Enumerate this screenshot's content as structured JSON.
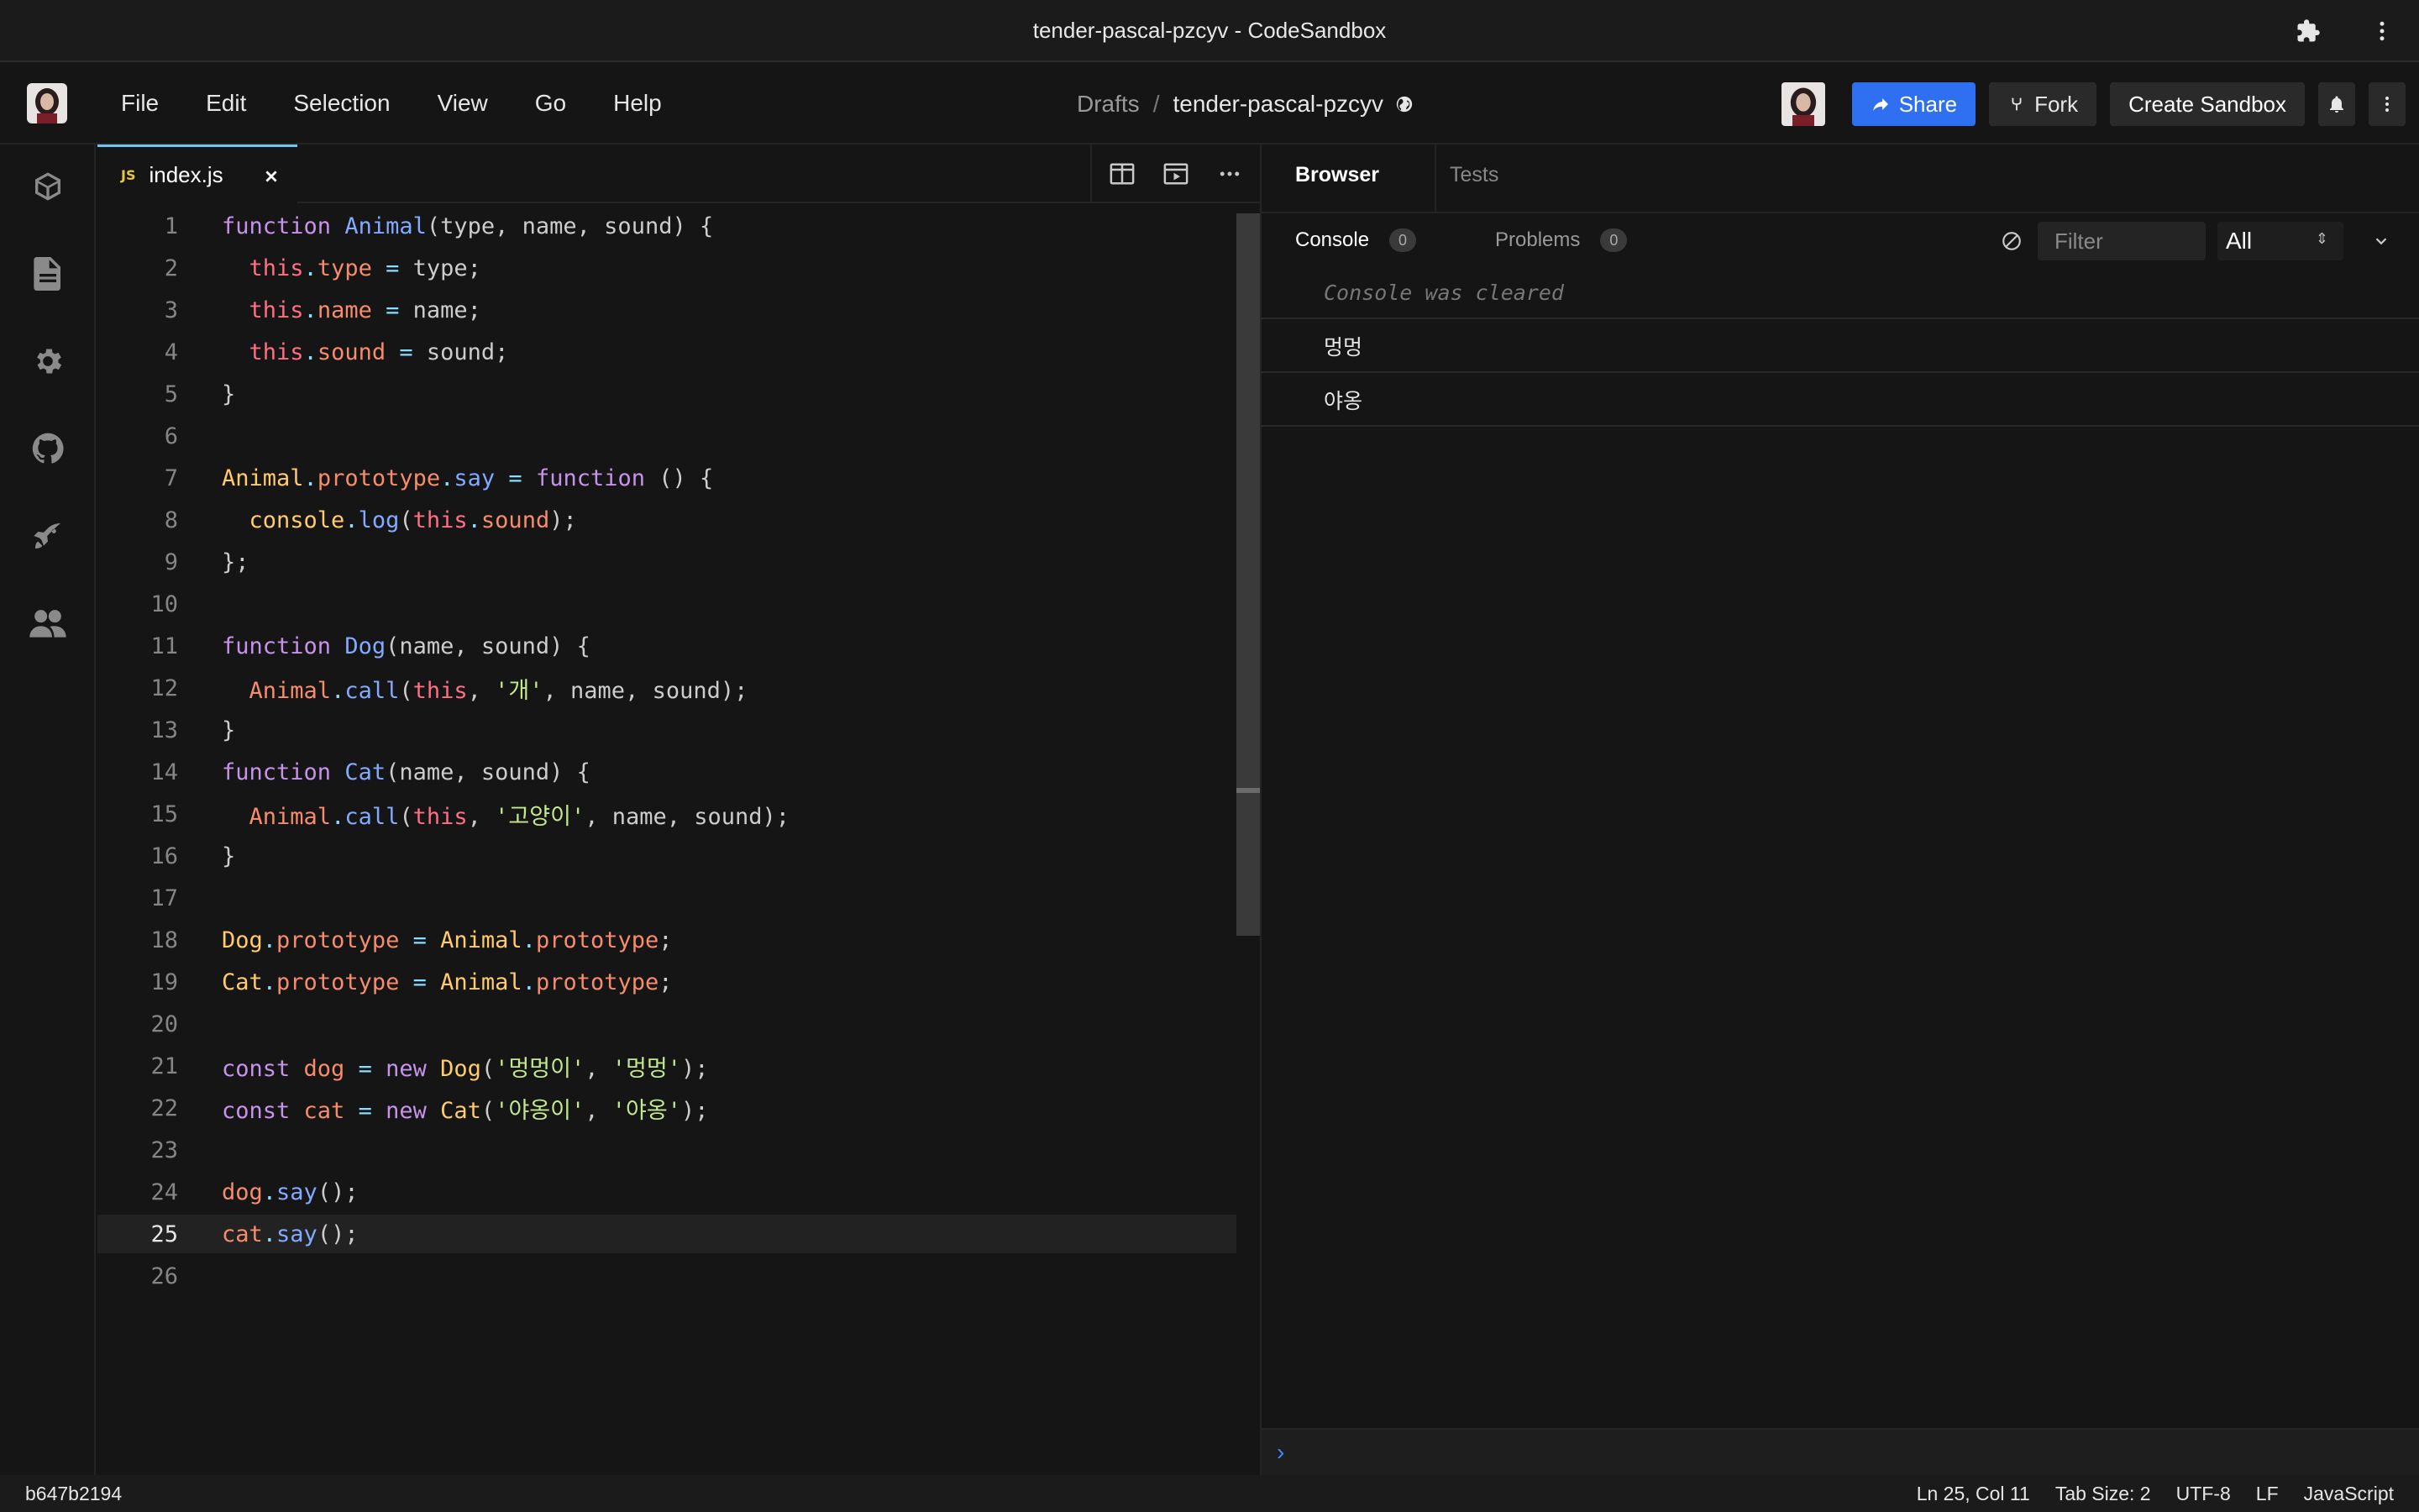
{
  "window": {
    "title": "tender-pascal-pzcyv - CodeSandbox"
  },
  "menu": [
    "File",
    "Edit",
    "Selection",
    "View",
    "Go",
    "Help"
  ],
  "breadcrumb": {
    "folder": "Drafts",
    "separator": "/",
    "sandbox": "tender-pascal-pzcyv"
  },
  "header_actions": {
    "share": "Share",
    "fork": "Fork",
    "create": "Create Sandbox"
  },
  "activity_icons": [
    "cube-icon",
    "file-icon",
    "gear-icon",
    "github-icon",
    "rocket-icon",
    "users-icon"
  ],
  "editor": {
    "tab": {
      "badge": "JS",
      "filename": "index.js"
    },
    "current_line": 25,
    "lines": [
      [
        [
          "function ",
          "k"
        ],
        [
          "Animal",
          "f"
        ],
        [
          "(type, name, sound) {",
          "p"
        ]
      ],
      [
        [
          "  ",
          "p"
        ],
        [
          "this",
          "r"
        ],
        [
          ".",
          "o"
        ],
        [
          "type",
          "t"
        ],
        [
          " = ",
          "o"
        ],
        [
          "type;",
          "p"
        ]
      ],
      [
        [
          "  ",
          "p"
        ],
        [
          "this",
          "r"
        ],
        [
          ".",
          "o"
        ],
        [
          "name",
          "t"
        ],
        [
          " = ",
          "o"
        ],
        [
          "name;",
          "p"
        ]
      ],
      [
        [
          "  ",
          "p"
        ],
        [
          "this",
          "r"
        ],
        [
          ".",
          "o"
        ],
        [
          "sound",
          "t"
        ],
        [
          " = ",
          "o"
        ],
        [
          "sound;",
          "p"
        ]
      ],
      [
        [
          "}",
          "p"
        ]
      ],
      [],
      [
        [
          "Animal",
          "c"
        ],
        [
          ".",
          "o"
        ],
        [
          "prototype",
          "t"
        ],
        [
          ".",
          "o"
        ],
        [
          "say",
          "f"
        ],
        [
          " = ",
          "o"
        ],
        [
          "function",
          "k"
        ],
        [
          " () {",
          "p"
        ]
      ],
      [
        [
          "  ",
          "p"
        ],
        [
          "console",
          "c"
        ],
        [
          ".",
          "o"
        ],
        [
          "log",
          "f"
        ],
        [
          "(",
          "p"
        ],
        [
          "this",
          "r"
        ],
        [
          ".",
          "o"
        ],
        [
          "sound",
          "t"
        ],
        [
          ");",
          "p"
        ]
      ],
      [
        [
          "};",
          "p"
        ]
      ],
      [],
      [
        [
          "function ",
          "k"
        ],
        [
          "Dog",
          "f"
        ],
        [
          "(name, sound) {",
          "p"
        ]
      ],
      [
        [
          "  ",
          "p"
        ],
        [
          "Animal",
          "t"
        ],
        [
          ".",
          "o"
        ],
        [
          "call",
          "f"
        ],
        [
          "(",
          "p"
        ],
        [
          "this",
          "r"
        ],
        [
          ", ",
          "p"
        ],
        [
          "'개'",
          "s"
        ],
        [
          ", name, sound);",
          "p"
        ]
      ],
      [
        [
          "}",
          "p"
        ]
      ],
      [
        [
          "function ",
          "k"
        ],
        [
          "Cat",
          "f"
        ],
        [
          "(name, sound) {",
          "p"
        ]
      ],
      [
        [
          "  ",
          "p"
        ],
        [
          "Animal",
          "t"
        ],
        [
          ".",
          "o"
        ],
        [
          "call",
          "f"
        ],
        [
          "(",
          "p"
        ],
        [
          "this",
          "r"
        ],
        [
          ", ",
          "p"
        ],
        [
          "'고양이'",
          "s"
        ],
        [
          ", name, sound);",
          "p"
        ]
      ],
      [
        [
          "}",
          "p"
        ]
      ],
      [],
      [
        [
          "Dog",
          "c"
        ],
        [
          ".",
          "o"
        ],
        [
          "prototype",
          "t"
        ],
        [
          " = ",
          "o"
        ],
        [
          "Animal",
          "c"
        ],
        [
          ".",
          "o"
        ],
        [
          "prototype",
          "t"
        ],
        [
          ";",
          "p"
        ]
      ],
      [
        [
          "Cat",
          "c"
        ],
        [
          ".",
          "o"
        ],
        [
          "prototype",
          "t"
        ],
        [
          " = ",
          "o"
        ],
        [
          "Animal",
          "c"
        ],
        [
          ".",
          "o"
        ],
        [
          "prototype",
          "t"
        ],
        [
          ";",
          "p"
        ]
      ],
      [],
      [
        [
          "const ",
          "k"
        ],
        [
          "dog",
          "t"
        ],
        [
          " = ",
          "o"
        ],
        [
          "new ",
          "k"
        ],
        [
          "Dog",
          "c"
        ],
        [
          "(",
          "p"
        ],
        [
          "'멍멍이'",
          "s"
        ],
        [
          ", ",
          "p"
        ],
        [
          "'멍멍'",
          "s"
        ],
        [
          ");",
          "p"
        ]
      ],
      [
        [
          "const ",
          "k"
        ],
        [
          "cat",
          "t"
        ],
        [
          " = ",
          "o"
        ],
        [
          "new ",
          "k"
        ],
        [
          "Cat",
          "c"
        ],
        [
          "(",
          "p"
        ],
        [
          "'야옹이'",
          "s"
        ],
        [
          ", ",
          "p"
        ],
        [
          "'야옹'",
          "s"
        ],
        [
          ");",
          "p"
        ]
      ],
      [],
      [
        [
          "dog",
          "t"
        ],
        [
          ".",
          "o"
        ],
        [
          "say",
          "f"
        ],
        [
          "();",
          "p"
        ]
      ],
      [
        [
          "cat",
          "t"
        ],
        [
          ".",
          "o"
        ],
        [
          "say",
          "f"
        ],
        [
          "();",
          "p"
        ]
      ],
      []
    ]
  },
  "panel": {
    "tabs": [
      "Browser",
      "Tests"
    ],
    "console_tab": "Console",
    "console_count": "0",
    "problems_tab": "Problems",
    "problems_count": "0",
    "filter_placeholder": "Filter",
    "level": "All",
    "cleared_message": "Console was cleared",
    "logs": [
      "멍멍",
      "야옹"
    ],
    "prompt": "›"
  },
  "status": {
    "commit": "b647b2194",
    "position": "Ln 25, Col 11",
    "tab_size": "Tab Size: 2",
    "encoding": "UTF-8",
    "eol": "LF",
    "language": "JavaScript"
  },
  "colors": {
    "accent": "#2f6ff1",
    "tab_indicator": "#6cc7f6"
  }
}
